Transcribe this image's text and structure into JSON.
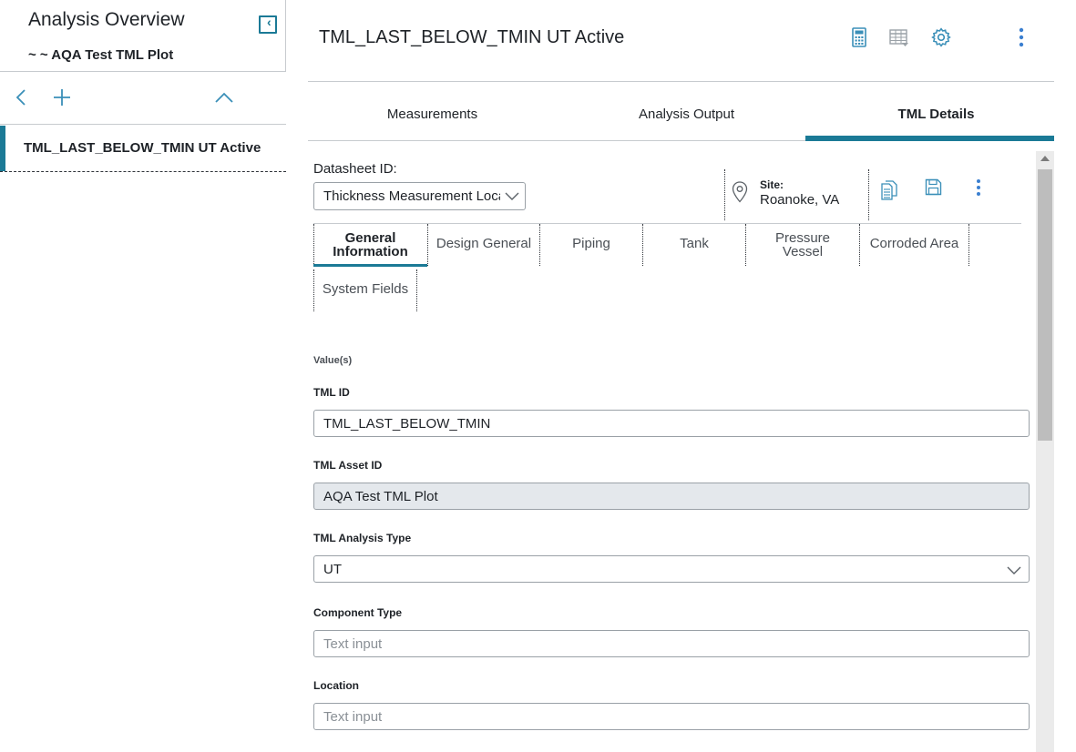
{
  "sidebar": {
    "title": "Analysis Overview",
    "subtitle": "~ ~ AQA Test TML Plot",
    "items": [
      {
        "label": "TML_LAST_BELOW_TMIN UT Active"
      }
    ]
  },
  "header": {
    "title": "TML_LAST_BELOW_TMIN UT Active"
  },
  "tabs": [
    {
      "label": "Measurements"
    },
    {
      "label": "Analysis Output"
    },
    {
      "label": "TML Details",
      "active": true
    }
  ],
  "datasheet": {
    "label": "Datasheet ID:",
    "selected": "Thickness Measurement Location",
    "site_label": "Site:",
    "site_value": "Roanoke, VA"
  },
  "sub_tabs": [
    {
      "label": "General\nInformation",
      "active": true
    },
    {
      "label": "Design General"
    },
    {
      "label": "Piping"
    },
    {
      "label": "Tank"
    },
    {
      "label": "Pressure\nVessel"
    },
    {
      "label": "Corroded Area"
    },
    {
      "label": "System Fields"
    }
  ],
  "form": {
    "section_label": "Value(s)",
    "fields": [
      {
        "label": "TML ID",
        "value": "TML_LAST_BELOW_TMIN",
        "type": "text"
      },
      {
        "label": "TML Asset ID",
        "value": "AQA Test TML Plot",
        "type": "readonly"
      },
      {
        "label": "TML Analysis Type",
        "value": "UT",
        "type": "select"
      },
      {
        "label": "Component Type",
        "placeholder": "Text input",
        "type": "text"
      },
      {
        "label": "Location",
        "placeholder": "Text input",
        "type": "text"
      }
    ]
  },
  "colors": {
    "accent": "#1b7a96",
    "icon_blue": "#3a8fb8",
    "readonly_bg": "#e4e8ec"
  },
  "icons": {
    "collapse": "chevron-left-icon",
    "back": "chevron-left-icon",
    "add": "plus-icon",
    "collapse_up": "chevron-up-icon",
    "calculator": "calculator-icon",
    "table": "table-icon",
    "settings": "gear-icon",
    "more": "kebab-menu-icon",
    "site": "location-pin-icon",
    "copy": "copy-document-icon",
    "save": "save-icon"
  }
}
